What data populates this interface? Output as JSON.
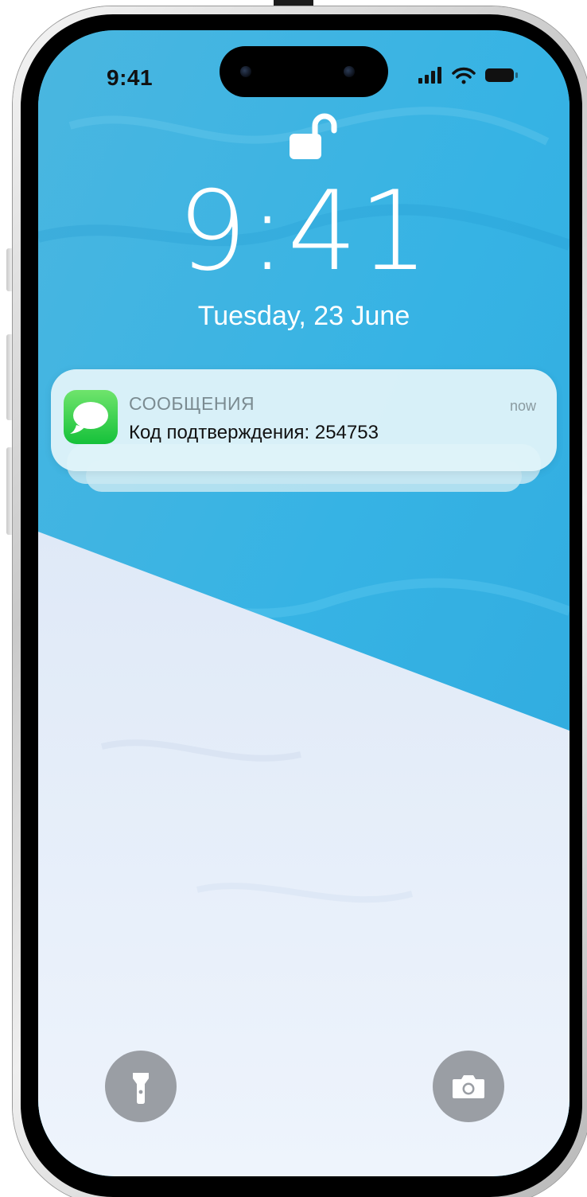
{
  "status_bar": {
    "time": "9:41",
    "icons": [
      "signal-icon",
      "wifi-icon",
      "battery-icon"
    ]
  },
  "lock_screen": {
    "lock_icon": "unlocked-padlock-icon",
    "time": "9:41",
    "date": "Tuesday,  23 June"
  },
  "notification": {
    "app_icon": "messages-icon",
    "app_name": "СООБЩЕНИЯ",
    "timestamp": "now",
    "body": "Код подтверждения: 254753"
  },
  "quick_actions": {
    "left_icon": "flashlight-icon",
    "right_icon": "camera-icon"
  },
  "colors": {
    "wallpaper_water": "#3ab7e3",
    "wallpaper_snow": "#e9f0fb",
    "messages_green": "#15c13a",
    "quick_button_gray": "#9a9ea4"
  }
}
